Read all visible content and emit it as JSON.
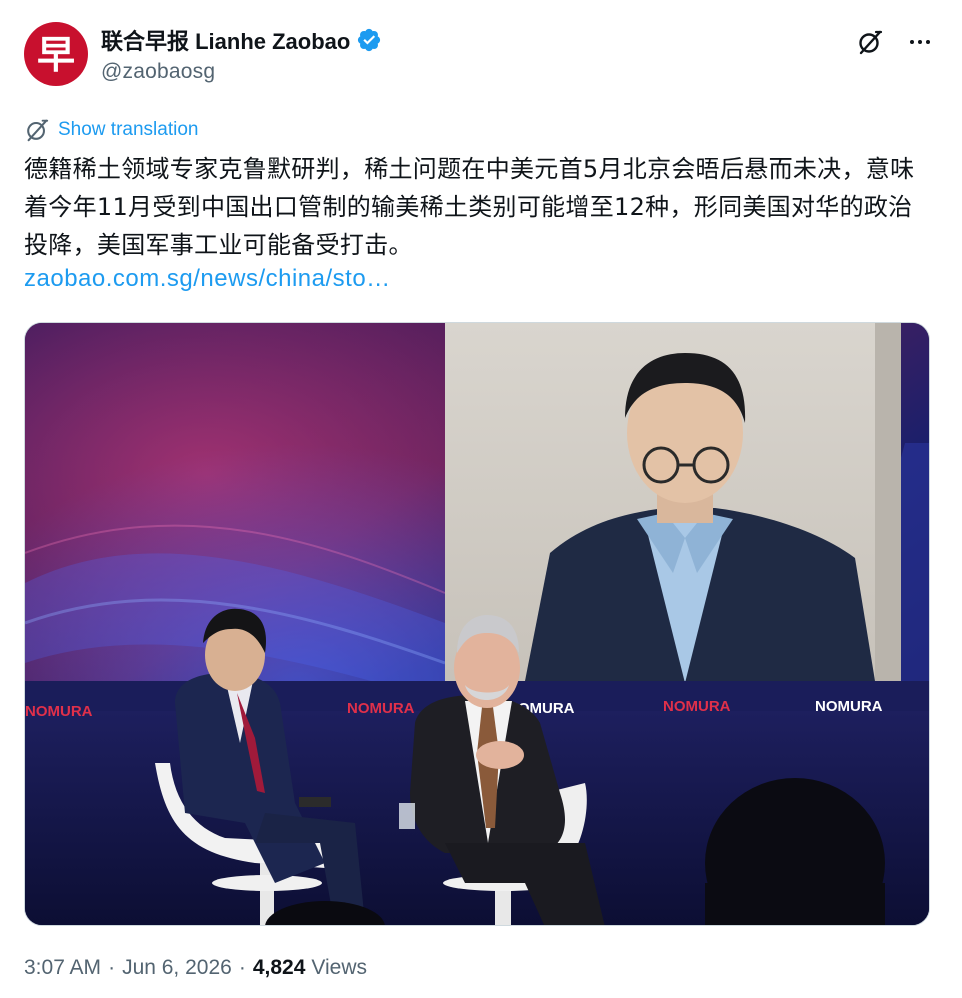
{
  "account": {
    "display_name": "联合早报 Lianhe Zaobao",
    "handle": "@zaobaosg",
    "avatar_glyph": "早",
    "avatar_color": "#c8102e",
    "verified_color": "#1d9bf0"
  },
  "actions": {
    "grok_icon": "grok-icon",
    "more_icon": "more-icon"
  },
  "translation": {
    "label": "Show translation",
    "icon": "translate-icon"
  },
  "tweet": {
    "text": "德籍稀土领域专家克鲁默研判，稀土问题在中美元首5月北京会晤后悬而未决，意味着今年11月受到中国出口管制的输美稀土类别可能增至12种，形同美国对华的政治投降，美国军事工业可能备受打击。",
    "link": "zaobao.com.sg/news/china/sto…"
  },
  "media": {
    "screen_logos": [
      "NOMURA",
      "NOMURA",
      "NOMURA",
      "NOMURA",
      "NOMURA"
    ]
  },
  "meta": {
    "time": "3:07 AM",
    "date": "Jun 6, 2026",
    "views_count": "4,824",
    "views_label": "Views"
  },
  "colors": {
    "link": "#1d9bf0",
    "secondary_text": "#536471",
    "primary_text": "#0f1419"
  }
}
